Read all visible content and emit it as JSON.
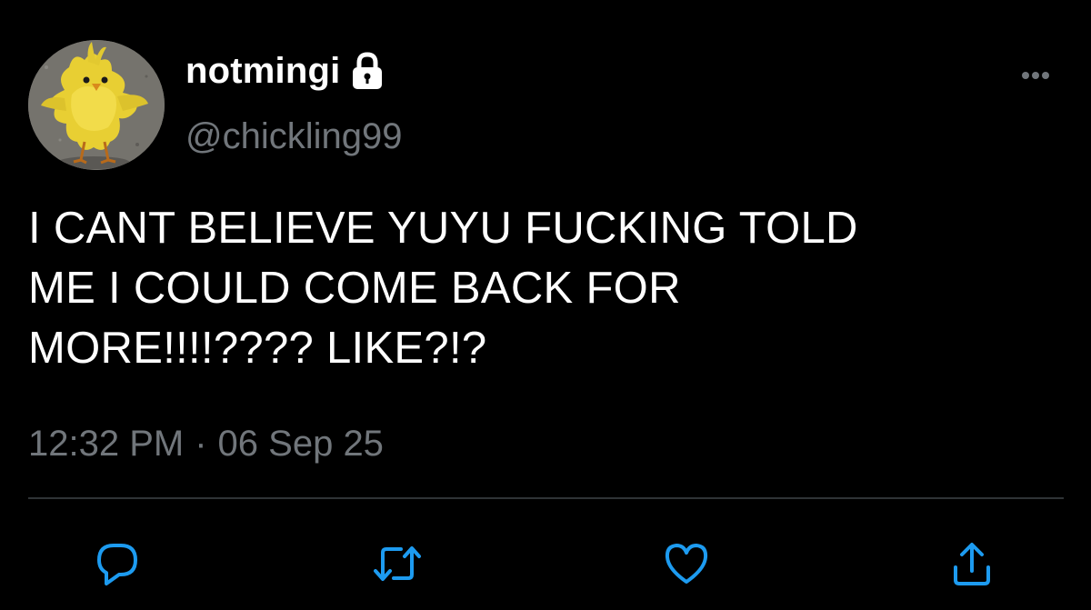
{
  "tweet": {
    "display_name": "notmingi",
    "handle": "@chickling99",
    "text": "I CANT BELIEVE YUYU FUCKING TOLD\nME I COULD COME BACK FOR\nMORE!!!!???? LIKE?!?",
    "time": "12:32 PM",
    "separator": "·",
    "date": "06 Sep 25"
  },
  "icons": {
    "lock": "lock-icon",
    "more": "more-horizontal-icon",
    "reply": "reply-icon",
    "retweet": "retweet-icon",
    "like": "heart-icon",
    "share": "share-icon"
  },
  "colors": {
    "background": "#000000",
    "primary_text": "#ffffff",
    "secondary_text": "#71767b",
    "divider": "#2f3336",
    "action_icon": "#1d9bf0"
  }
}
